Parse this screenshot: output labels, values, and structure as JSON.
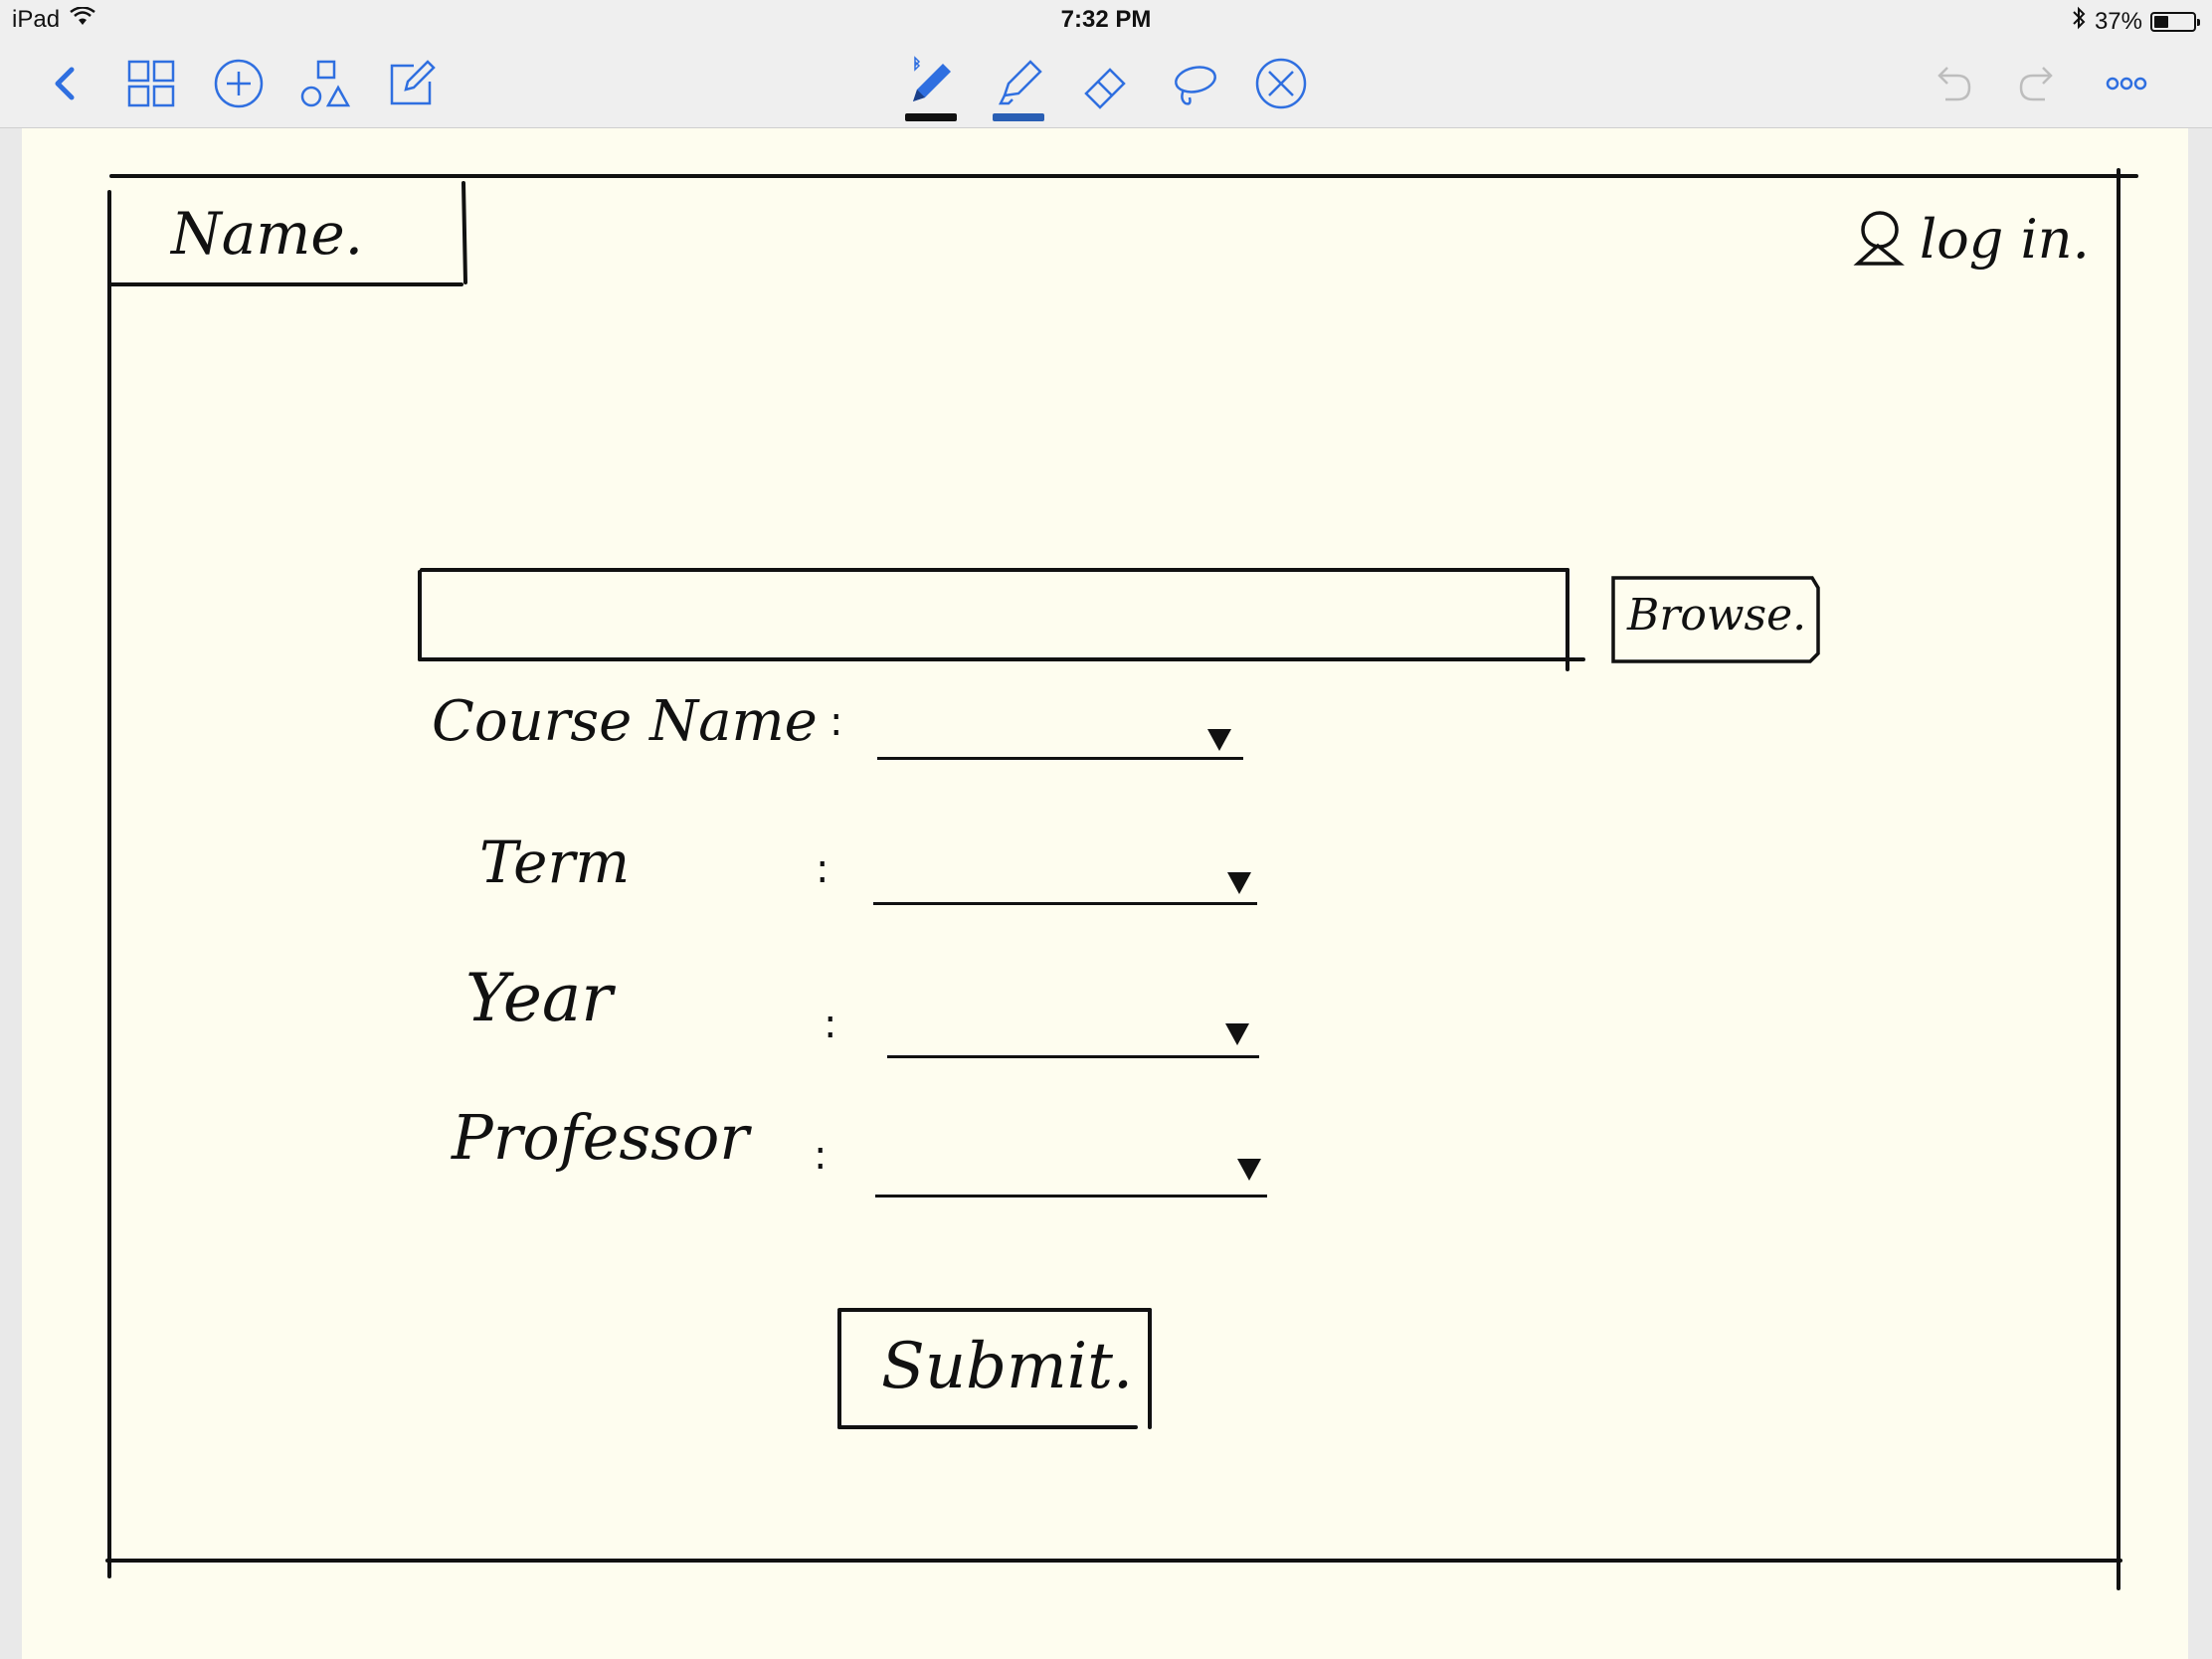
{
  "status_bar": {
    "device": "iPad",
    "time": "7:32 PM",
    "battery": "37%",
    "battery_level": 0.37
  },
  "toolbar": {
    "left_icons": [
      "back-chevron-icon",
      "grid-icon",
      "add-circle-icon",
      "shapes-icon",
      "compose-icon"
    ],
    "center_tools": [
      "pen-icon",
      "highlighter-icon",
      "eraser-icon",
      "lasso-icon",
      "close-circle-icon"
    ],
    "right_icons": [
      "undo-icon",
      "redo-icon",
      "more-icon"
    ],
    "accent_color": "#2f6fe0",
    "pen_underline_color": "#111111",
    "highlighter_underline_color": "#2a5fb4"
  },
  "sketch": {
    "name_tab": "Name.",
    "login": "log in.",
    "browse": "Browse.",
    "fields": [
      {
        "label": "Course Name",
        "colon": ":"
      },
      {
        "label": "Term",
        "colon": ":"
      },
      {
        "label": "Year",
        "colon": ":"
      },
      {
        "label": "Professor",
        "colon": ":"
      }
    ],
    "submit": "Submit."
  }
}
